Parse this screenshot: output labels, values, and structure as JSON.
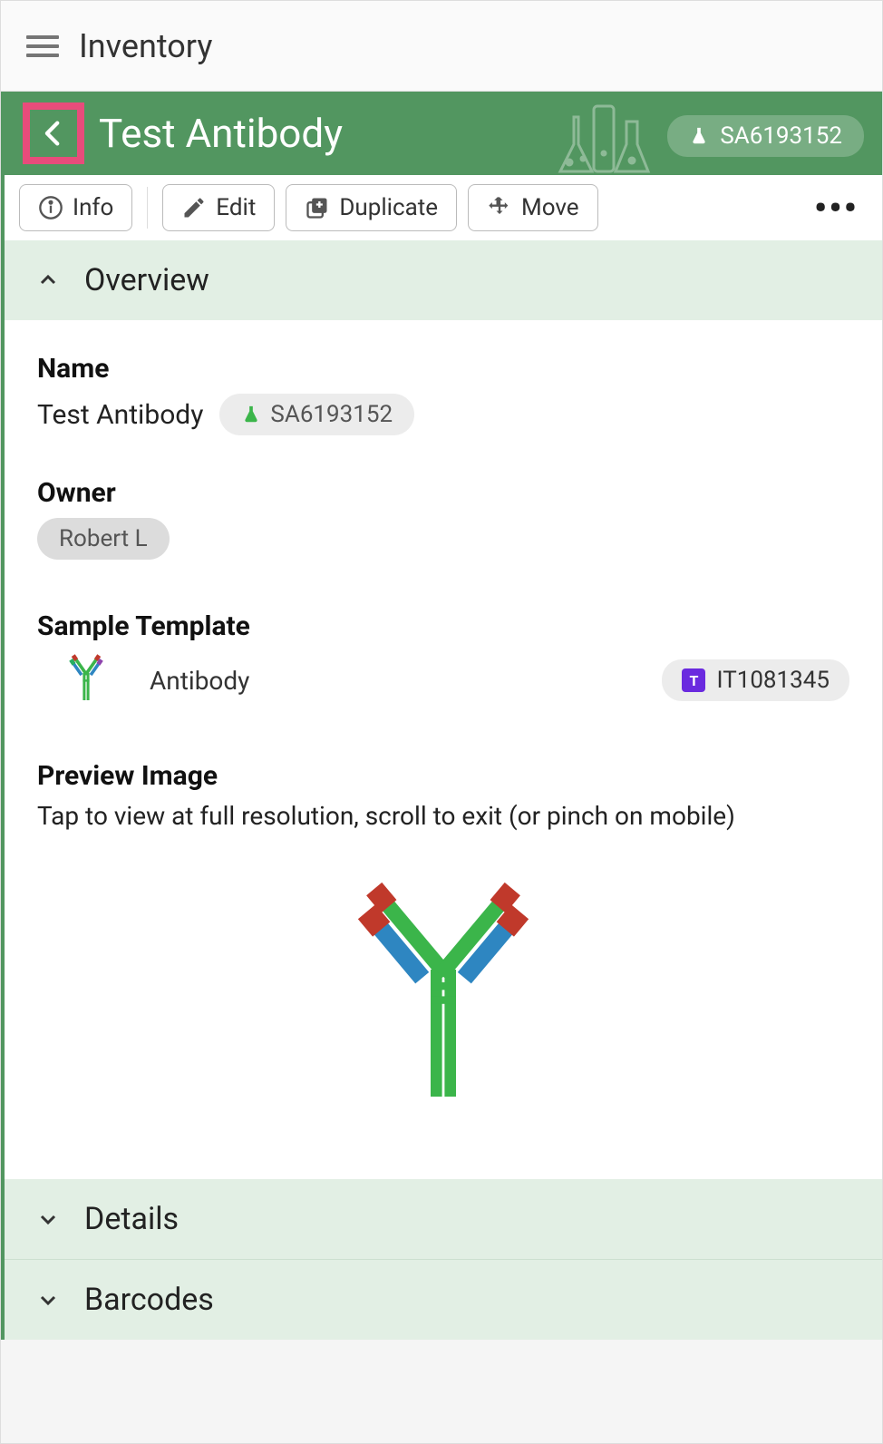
{
  "topbar": {
    "title": "Inventory"
  },
  "header": {
    "title": "Test Antibody",
    "badge_id": "SA6193152"
  },
  "toolbar": {
    "info_label": "Info",
    "edit_label": "Edit",
    "duplicate_label": "Duplicate",
    "move_label": "Move"
  },
  "sections": {
    "overview": {
      "title": "Overview",
      "name_label": "Name",
      "name_value": "Test Antibody",
      "name_badge": "SA6193152",
      "owner_label": "Owner",
      "owner_value": "Robert L",
      "template_label": "Sample Template",
      "template_name": "Antibody",
      "template_badge": "IT1081345",
      "preview_label": "Preview Image",
      "preview_hint": "Tap to view at full resolution, scroll to exit (or pinch on mobile)"
    },
    "details": {
      "title": "Details"
    },
    "barcodes": {
      "title": "Barcodes"
    }
  }
}
